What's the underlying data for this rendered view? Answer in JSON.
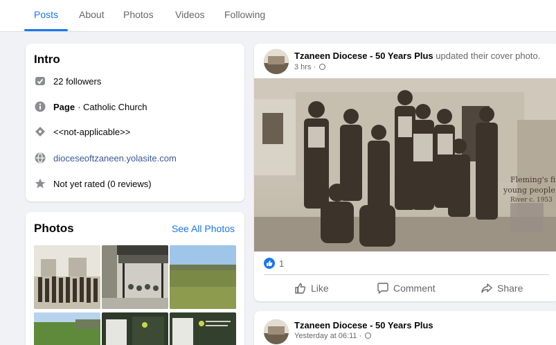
{
  "tabs": [
    "Posts",
    "About",
    "Photos",
    "Videos",
    "Following"
  ],
  "intro": {
    "title": "Intro",
    "followers": "22 followers",
    "page_label": "Page",
    "page_category": "· Catholic Church",
    "not_applicable": "<<not-applicable>>",
    "website": "dioceseoftzaneen.yolasite.com",
    "rating": "Not yet rated (0 reviews)"
  },
  "photos": {
    "title": "Photos",
    "see_all": "See All Photos"
  },
  "post": {
    "author": "Tzaneen Diocese - 50 Years Plus",
    "action": " updated their cover photo.",
    "time": "3 hrs ·",
    "reaction_count": "1",
    "like_label": "Like",
    "comment_label": "Comment",
    "share_label": "Share",
    "photo_caption_1": "Fleming's first",
    "photo_caption_2": "young people",
    "photo_caption_3": "River c. 1953"
  },
  "post2": {
    "author": "Tzaneen Diocese - 50 Years Plus",
    "time": "Yesterday at 06:11 ·"
  },
  "colors": {
    "accent": "#1877f2",
    "link": "#385898",
    "secondary_text": "#65676b"
  }
}
